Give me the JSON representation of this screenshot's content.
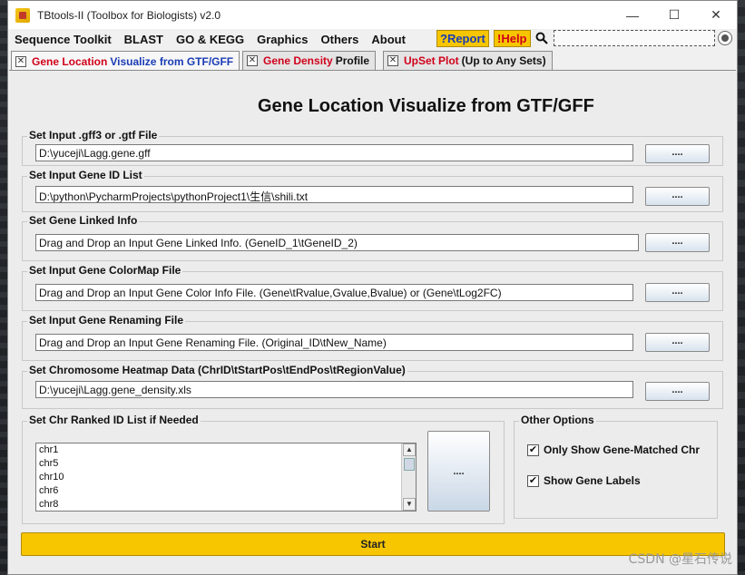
{
  "window": {
    "title": "TBtools-II (Toolbox for Biologists) v2.0",
    "controls": {
      "minimize": "—",
      "maximize": "☐",
      "close": "✕"
    }
  },
  "menu": {
    "items": [
      "Sequence Toolkit",
      "BLAST",
      "GO & KEGG",
      "Graphics",
      "Others",
      "About"
    ],
    "report": "?Report",
    "help": "!Help"
  },
  "tabs": [
    {
      "highlight": "Gene Location",
      "rest": "Visualize from GTF/GFF",
      "close": "✕"
    },
    {
      "highlight": "Gene Density",
      "rest": "Profile",
      "close": "✕"
    },
    {
      "highlight": "UpSet Plot",
      "rest": "(Up to Any Sets)",
      "close": "✕"
    }
  ],
  "page": {
    "title": "Gene Location Visualize from GTF/GFF",
    "browse_label": "....",
    "inputs": [
      {
        "label": "Set Input .gff3 or .gtf File",
        "value": "D:\\yuceji\\Lagg.gene.gff"
      },
      {
        "label": "Set Input Gene ID List",
        "value": "D:\\python\\PycharmProjects\\pythonProject1\\生信\\shili.txt"
      },
      {
        "label": "Set Gene Linked Info",
        "value": "Drag and Drop an Input Gene Linked Info. (GeneID_1\\tGeneID_2)"
      },
      {
        "label": "Set Input Gene ColorMap File",
        "value": "Drag and Drop an Input Gene Color Info File. (Gene\\tRvalue,Gvalue,Bvalue) or (Gene\\tLog2FC)"
      },
      {
        "label": "Set Input Gene Renaming File",
        "value": "Drag and Drop an Input Gene Renaming File. (Original_ID\\tNew_Name)"
      },
      {
        "label": "Set Chromosome Heatmap Data (ChrID\\tStartPos\\tEndPos\\tRegionValue)",
        "value": "D:\\yuceji\\Lagg.gene_density.xls"
      }
    ],
    "chr_list": {
      "label": "Set Chr Ranked ID List if Needed",
      "items": [
        "chr1",
        "chr5",
        "chr10",
        "chr6",
        "chr8"
      ],
      "button": "...."
    },
    "options": {
      "label": "Other Options",
      "only_matched": "Only Show Gene-Matched Chr",
      "show_labels": "Show Gene Labels",
      "check_mark": "✔"
    },
    "start": "Start"
  },
  "watermark": "CSDN @星石传说"
}
